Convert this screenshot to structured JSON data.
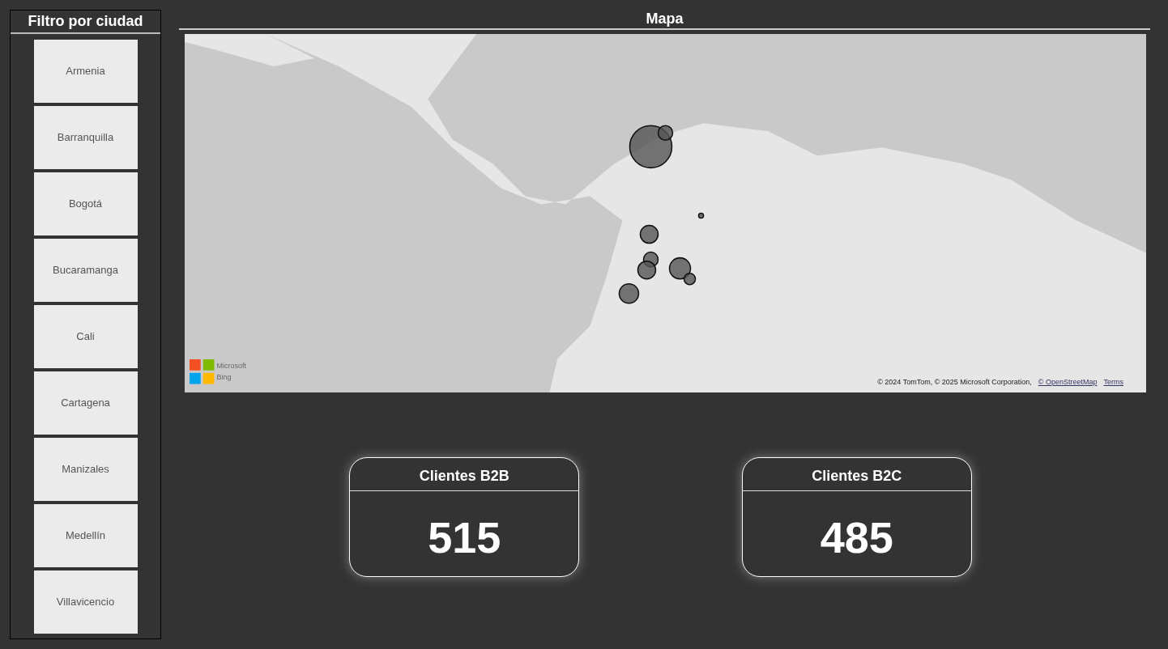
{
  "slicer": {
    "title": "Filtro por ciudad",
    "items": [
      {
        "label": "Armenia",
        "selected": false
      },
      {
        "label": "Barranquilla",
        "selected": false
      },
      {
        "label": "Bogotá",
        "selected": false
      },
      {
        "label": "Bucaramanga",
        "selected": false
      },
      {
        "label": "Cali",
        "selected": false
      },
      {
        "label": "Cartagena",
        "selected": false
      },
      {
        "label": "Manizales",
        "selected": false
      },
      {
        "label": "Medellín",
        "selected": false
      },
      {
        "label": "Villavicencio",
        "selected": false
      }
    ]
  },
  "map": {
    "title": "Mapa",
    "logo_text": "Microsoft Bing",
    "attribution": "© 2024 TomTom, © 2025 Microsoft Corporation,",
    "attribution_links": [
      "© OpenStreetMap",
      "Terms"
    ]
  },
  "cards": [
    {
      "title": "Clientes B2B",
      "value": "515"
    },
    {
      "title": "Clientes B2C",
      "value": "485"
    }
  ]
}
